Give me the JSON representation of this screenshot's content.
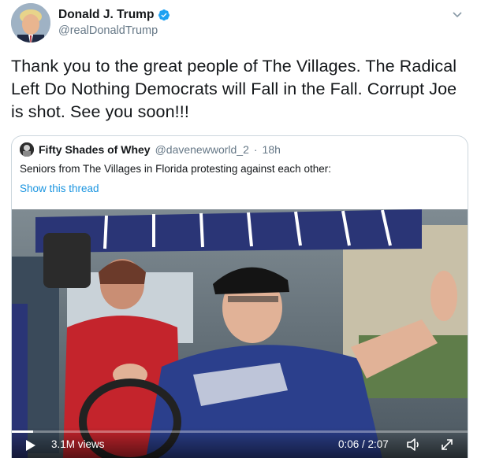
{
  "author": {
    "name": "Donald J. Trump",
    "handle": "@realDonaldTrump",
    "verified_icon": "verified-badge-icon"
  },
  "tweet": {
    "text": "Thank you to the great people of The Villages. The Radical Left Do Nothing Democrats will Fall in the Fall. Corrupt Joe is shot. See you soon!!!"
  },
  "quoted": {
    "name": "Fifty Shades of Whey",
    "handle": "@davenewworld_2",
    "separator": "·",
    "time": "18h",
    "text": "Seniors from The Villages in Florida protesting against each other:",
    "thread_link": "Show this thread"
  },
  "video": {
    "views": "3.1M views",
    "time": "0:06 / 2:07",
    "progress_fraction": 0.047
  },
  "colors": {
    "link": "#1b95e0",
    "secondary_text": "#657786",
    "border": "#ccd6dd",
    "verified": "#1da1f2"
  }
}
